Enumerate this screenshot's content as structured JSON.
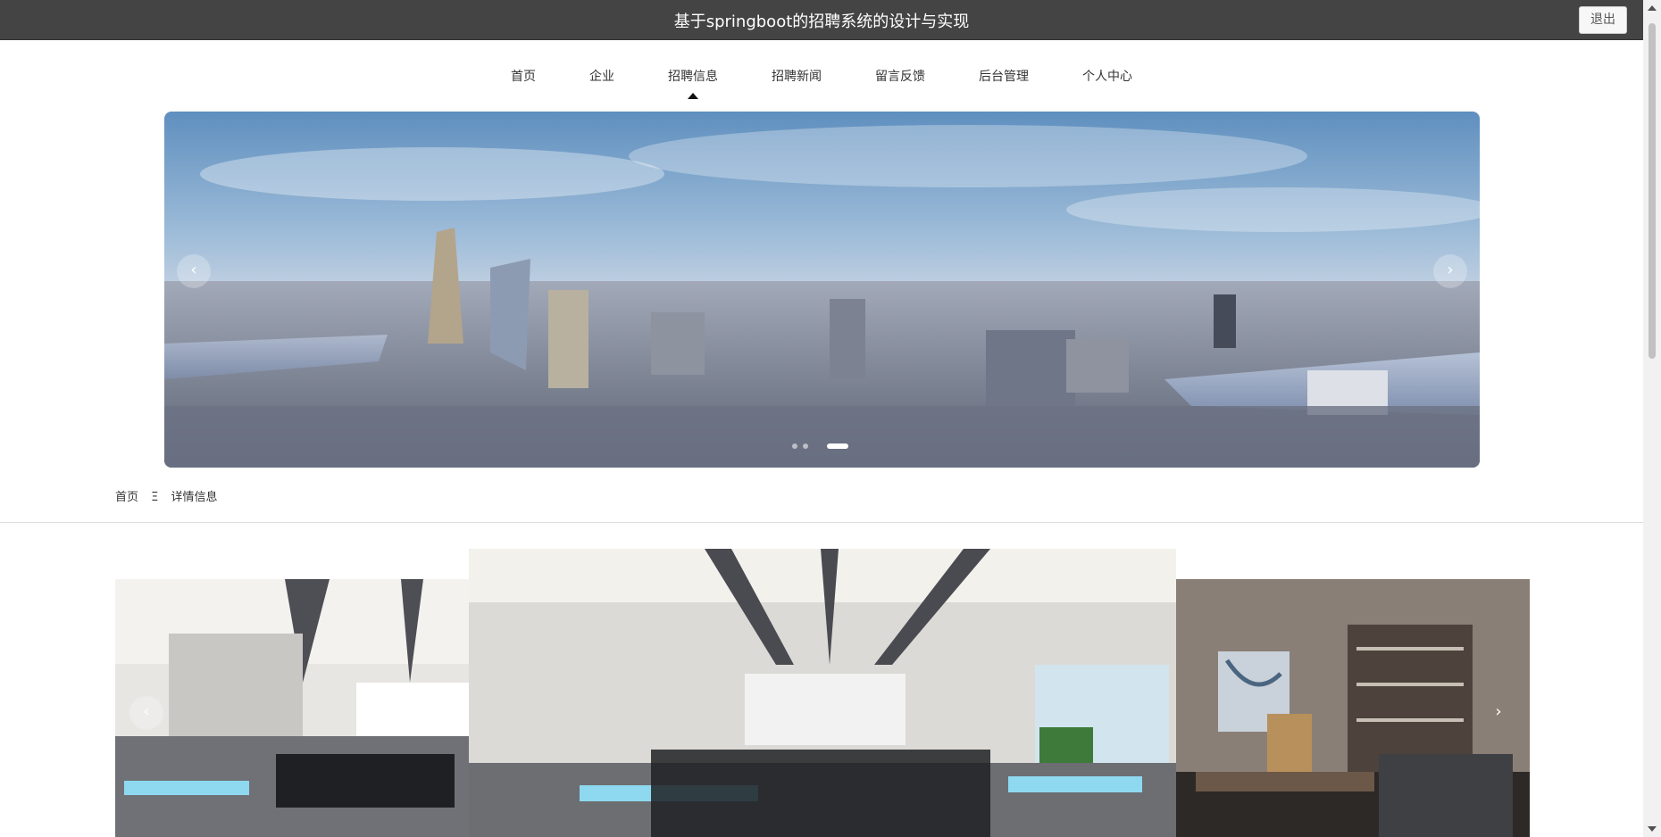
{
  "header": {
    "title": "基于springboot的招聘系统的设计与实现",
    "logout_label": "退出"
  },
  "nav": {
    "items": [
      {
        "label": "首页"
      },
      {
        "label": "企业"
      },
      {
        "label": "招聘信息"
      },
      {
        "label": "招聘新闻"
      },
      {
        "label": "留言反馈"
      },
      {
        "label": "后台管理"
      },
      {
        "label": "个人中心"
      }
    ],
    "active_index": 2
  },
  "banner": {
    "prev_icon": "chevron-left-icon",
    "next_icon": "chevron-right-icon",
    "prev_glyph": "‹",
    "next_glyph": "›",
    "slide_count": 3,
    "active_slide": 2
  },
  "breadcrumb": {
    "home": "首页",
    "separator": "Ξ",
    "current": "详情信息"
  },
  "gallery": {
    "prev_glyph": "‹",
    "next_glyph": "›"
  },
  "colors": {
    "header_bg": "#444444",
    "accent": "#111111"
  }
}
